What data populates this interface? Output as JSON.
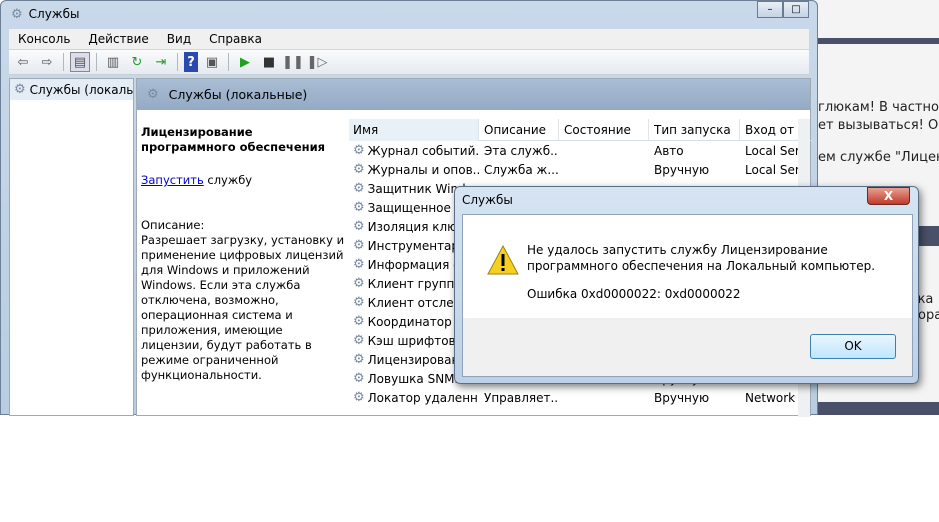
{
  "background_page": {
    "lines": [
      "глюкам! В частно",
      "ет вызываться! Об",
      "ем службе \"Лицен",
      "и ка",
      "ора"
    ]
  },
  "window": {
    "title": "Службы",
    "menu": [
      "Консоль",
      "Действие",
      "Вид",
      "Справка"
    ],
    "toolbar_icons": [
      "back-icon",
      "forward-icon",
      "show-hide-tree-icon",
      "properties-icon",
      "refresh-icon",
      "export-icon",
      "help-icon",
      "show-action-pane-icon",
      "start-icon",
      "stop-icon",
      "pause-icon",
      "resume-icon"
    ],
    "tree_item": "Службы (локалы",
    "pane_title": "Службы (локальные)",
    "details": {
      "service_name": "Лицензирование программного обеспечения",
      "start_link": "Запустить",
      "start_suffix": " службу",
      "description_label": "Описание:",
      "description": "Разрешает загрузку, установку и применение цифровых лицензий для Windows и приложений Windows. Если эта служба отключена, возможно, операционная система и приложения, имеющие лицензии, будут работать в режиме ограниченной функциональности."
    },
    "columns": [
      "Имя",
      "Описание",
      "Состояние",
      "Тип запуска",
      "Вход от и"
    ],
    "rows": [
      [
        "Журнал событий...",
        "Эта служб...",
        "",
        "Авто",
        "Local Serv"
      ],
      [
        "Журналы и опов...",
        "Служба ж...",
        "",
        "Вручную",
        "Local Serv"
      ],
      [
        "Защитник Wind",
        "",
        "",
        "",
        ""
      ],
      [
        "Защищенное х",
        "",
        "",
        "",
        ""
      ],
      [
        "Изоляция ключ",
        "",
        "",
        "",
        ""
      ],
      [
        "Инструментари",
        "",
        "",
        "",
        ""
      ],
      [
        "Информация о",
        "",
        "",
        "",
        ""
      ],
      [
        "Клиент группов",
        "",
        "",
        "",
        ""
      ],
      [
        "Клиент отслежи",
        "",
        "",
        "",
        ""
      ],
      [
        "Координатор р",
        "",
        "",
        "",
        ""
      ],
      [
        "Кэш шрифтов",
        "",
        "",
        "",
        ""
      ],
      [
        "Лицензировани",
        "",
        "",
        "",
        ""
      ],
      [
        "Ловушка SNMP",
        "",
        "",
        "Вручную",
        ""
      ],
      [
        "Локатор удаленн...",
        "Управляет...",
        "",
        "Вручную",
        "Network"
      ]
    ]
  },
  "dialog": {
    "title": "Службы",
    "message": "Не удалось запустить службу Лицензирование программного обеспечения на Локальный компьютер.",
    "error": "Ошибка 0xd0000022: 0xd0000022",
    "ok_label": "OK",
    "close_label": "X"
  }
}
